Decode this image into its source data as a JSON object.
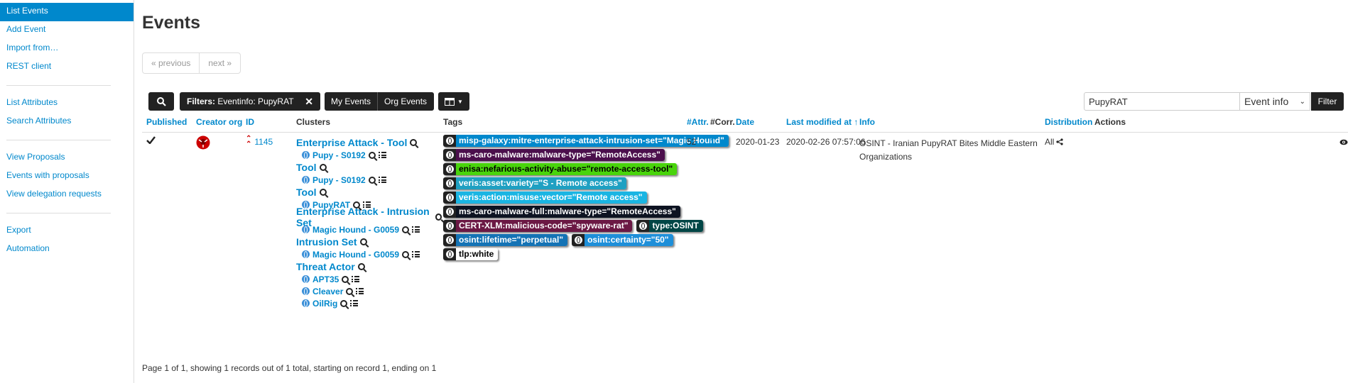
{
  "sidebar": {
    "group1": [
      "List Events",
      "Add Event",
      "Import from…",
      "REST client"
    ],
    "group2": [
      "List Attributes",
      "Search Attributes"
    ],
    "group3": [
      "View Proposals",
      "Events with proposals",
      "View delegation requests"
    ],
    "group4": [
      "Export",
      "Automation"
    ]
  },
  "page": {
    "title": "Events"
  },
  "pager": {
    "previous": "« previous",
    "next": "next »"
  },
  "toolbar": {
    "filter_label": "Filters:",
    "filter_value": "Eventinfo: PupyRAT",
    "my_events": "My Events",
    "org_events": "Org Events",
    "search_value": "PupyRAT",
    "field_select": "Event info",
    "filter_button": "Filter"
  },
  "columns": {
    "published": "Published",
    "creator_org": "Creator org",
    "id": "ID",
    "clusters": "Clusters",
    "tags": "Tags",
    "attr": "#Attr.",
    "corr": "#Corr.",
    "date": "Date",
    "last_modified": "Last modified at ↑",
    "info": "Info",
    "distribution": "Distribution",
    "actions": "Actions"
  },
  "row": {
    "published_icon": "checkmark-icon",
    "id": "1145",
    "attr": "52",
    "corr": "1",
    "date": "2020-01-23",
    "last_modified": "2020-02-26 07:57:06",
    "info": "OSINT - Iranian PupyRAT Bites Middle Eastern Organizations",
    "distribution": "All"
  },
  "clusters": [
    {
      "title": "Enterprise Attack - Tool",
      "items": [
        "Pupy - S0192"
      ]
    },
    {
      "title": "Tool",
      "items": [
        "Pupy - S0192"
      ]
    },
    {
      "title": "Tool",
      "items": [
        "PupyRAT"
      ]
    },
    {
      "title": "Enterprise Attack - Intrusion Set",
      "items": [
        "Magic Hound - G0059"
      ]
    },
    {
      "title": "Intrusion Set",
      "items": [
        "Magic Hound - G0059"
      ]
    },
    {
      "title": "Threat Actor",
      "items": [
        "APT35",
        "Cleaver",
        "OilRig"
      ]
    }
  ],
  "tags": [
    [
      {
        "text": "misp-galaxy:mitre-enterprise-attack-intrusion-set=\"Magic Hound\"",
        "bg": "#0088cc",
        "fg": "#ffffff"
      }
    ],
    [
      {
        "text": "ms-caro-malware:malware-type=\"RemoteAccess\"",
        "bg": "#4b0f4c",
        "fg": "#ffffff"
      }
    ],
    [
      {
        "text": "enisa:nefarious-activity-abuse=\"remote-access-tool\"",
        "bg": "#49d40c",
        "fg": "#000000"
      }
    ],
    [
      {
        "text": "veris:asset:variety=\"S - Remote access\"",
        "bg": "#1fa0c2",
        "fg": "#ffffff"
      }
    ],
    [
      {
        "text": "veris:action:misuse:vector=\"Remote access\"",
        "bg": "#1ab5e3",
        "fg": "#ffffff"
      }
    ],
    [
      {
        "text": "ms-caro-malware-full:malware-type=\"RemoteAccess\"",
        "bg": "#0d1321",
        "fg": "#ffffff"
      }
    ],
    [
      {
        "text": "CERT-XLM:malicious-code=\"spyware-rat\"",
        "bg": "#6b1844",
        "fg": "#ffffff"
      },
      {
        "text": "type:OSINT",
        "bg": "#004646",
        "fg": "#ffffff"
      }
    ],
    [
      {
        "text": "osint:lifetime=\"perpetual\"",
        "bg": "#1473b5",
        "fg": "#ffffff"
      },
      {
        "text": "osint:certainty=\"50\"",
        "bg": "#1e8fd9",
        "fg": "#ffffff"
      }
    ],
    [
      {
        "text": "tlp:white",
        "bg": "#ffffff",
        "fg": "#000000"
      }
    ]
  ],
  "footer": "Page 1 of 1, showing 1 records out of 1 total, starting on record 1, ending on 1",
  "colors": {
    "accent": "#0088cc",
    "dark": "#222222",
    "org_logo": "#cc0000"
  }
}
